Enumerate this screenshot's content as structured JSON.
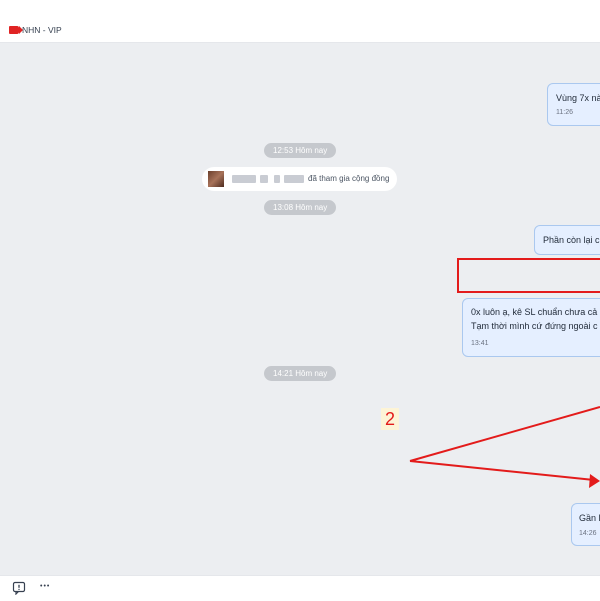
{
  "header": {
    "title": "NHN - VIP",
    "tag_color": "#e02424"
  },
  "separators": [
    "12:53 Hôm nay",
    "13:08 Hôm nay",
    "14:21 Hôm nay"
  ],
  "system_notice": {
    "text": "đã tham gia cộng đồng"
  },
  "messages": [
    {
      "lines": [
        "Vùng 7x nà"
      ],
      "time": "11:26"
    },
    {
      "lines": [
        "Phần còn lại c"
      ],
      "time": ""
    },
    {
      "lines": [
        "0x luôn ạ, kê SL chuẩn chưa cả",
        "Tạm thời mình cứ đứng ngoài c"
      ],
      "time": "13:41"
    },
    {
      "lines": [
        "Gần l"
      ],
      "time": "14:26"
    }
  ],
  "annotation": {
    "number": "2",
    "color": "#e31b1b"
  },
  "footer": {
    "icons": [
      "comment-alert-icon",
      "more-icon"
    ],
    "more_glyph": "•••"
  },
  "colors": {
    "chat_bg": "#eceef1",
    "bubble_bg": "#e5efff",
    "bubble_border": "#aac8ef",
    "separator_bg": "#c5c8cd"
  }
}
